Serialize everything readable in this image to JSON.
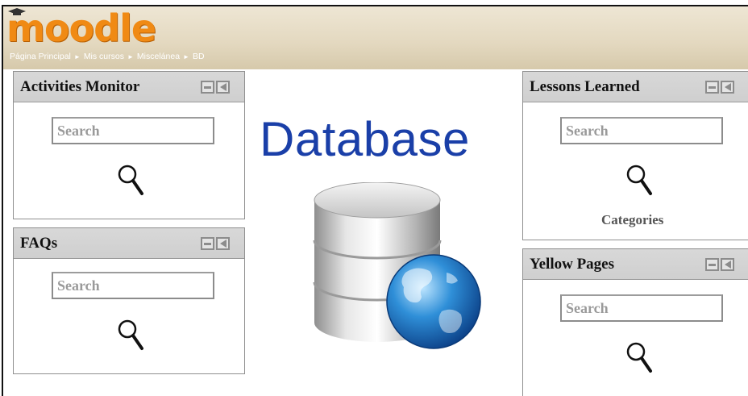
{
  "app": {
    "logo_text": "moodle"
  },
  "breadcrumb": [
    "Página Principal",
    "Mis cursos",
    "Miscelánea",
    "BD"
  ],
  "breadcrumb_separator": "►",
  "main": {
    "title": "Database",
    "graphic": "database-with-globe-icon"
  },
  "blocks": {
    "activities_monitor": {
      "title": "Activities Monitor",
      "search_placeholder": "Search"
    },
    "faqs": {
      "title": "FAQs",
      "search_placeholder": "Search"
    },
    "lessons_learned": {
      "title": "Lessons Learned",
      "search_placeholder": "Search",
      "link_label": "Categories"
    },
    "yellow_pages": {
      "title": "Yellow Pages",
      "search_placeholder": "Search"
    }
  },
  "icons": {
    "block_hide": "minimize-icon",
    "block_dock": "dock-left-icon",
    "search": "magnifier-icon"
  },
  "colors": {
    "logo": "#f08a14",
    "header_bg": "#e3d8bf",
    "title_blue": "#1a3fa8",
    "block_header": "#d3d3d3"
  }
}
